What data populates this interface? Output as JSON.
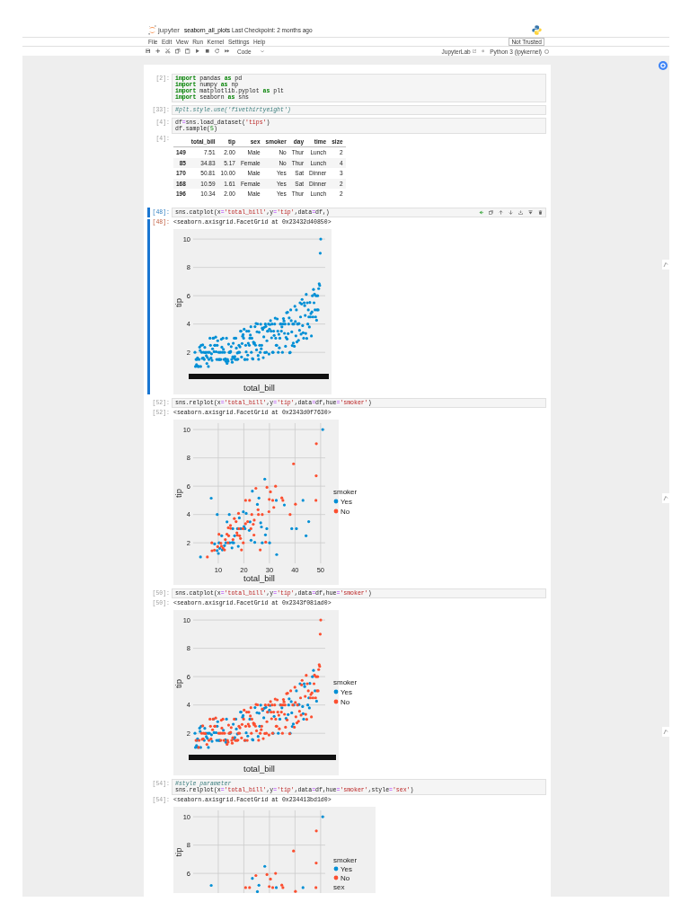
{
  "header": {
    "logo_text": "jupyter",
    "notebook_name": "seaborn_all_plots",
    "checkpoint": "Last Checkpoint: 2 months ago"
  },
  "menu": [
    "File",
    "Edit",
    "View",
    "Run",
    "Kernel",
    "Settings",
    "Help"
  ],
  "trust_status": "Not Trusted",
  "toolbar": {
    "cell_type": "Code",
    "lab_link": "JupyterLab",
    "kernel": "Python 3 (ipykernel)",
    "kernel_busy": false
  },
  "cells": [
    {
      "selected": false,
      "input_prompt": "[2]:",
      "lines": [
        [
          {
            "kind": "keyword",
            "text": "import"
          },
          {
            "kind": "plain",
            "text": " pandas "
          },
          {
            "kind": "keyword",
            "text": "as"
          },
          {
            "kind": "plain",
            "text": " pd"
          }
        ],
        [
          {
            "kind": "keyword",
            "text": "import"
          },
          {
            "kind": "plain",
            "text": " numpy "
          },
          {
            "kind": "keyword",
            "text": "as"
          },
          {
            "kind": "plain",
            "text": " np"
          }
        ],
        [
          {
            "kind": "keyword",
            "text": "import"
          },
          {
            "kind": "plain",
            "text": " matplotlib.pyplot "
          },
          {
            "kind": "keyword",
            "text": "as"
          },
          {
            "kind": "plain",
            "text": " plt"
          }
        ],
        [
          {
            "kind": "keyword",
            "text": "import"
          },
          {
            "kind": "plain",
            "text": " seaborn "
          },
          {
            "kind": "keyword",
            "text": "as"
          },
          {
            "kind": "plain",
            "text": " sns"
          }
        ]
      ]
    },
    {
      "selected": false,
      "input_prompt": "[33]:",
      "lines": [
        [
          {
            "kind": "comment",
            "text": "#plt.style.use('fivethirtyeight')"
          }
        ]
      ]
    },
    {
      "selected": false,
      "input_prompt": "[4]:",
      "lines": [
        [
          {
            "kind": "plain",
            "text": "df"
          },
          {
            "kind": "operator",
            "text": "="
          },
          {
            "kind": "plain",
            "text": "sns.load_dataset("
          },
          {
            "kind": "string",
            "text": "'tips'"
          },
          {
            "kind": "plain",
            "text": ")"
          }
        ],
        [
          {
            "kind": "plain",
            "text": "df.sample("
          },
          {
            "kind": "number",
            "text": "5"
          },
          {
            "kind": "plain",
            "text": ")"
          }
        ]
      ],
      "output": {
        "kind": "table",
        "prompt": "[4]:",
        "columns": [
          "total_bill",
          "tip",
          "sex",
          "smoker",
          "day",
          "time",
          "size"
        ],
        "rows": [
          {
            "index": "149",
            "cells": [
              "7.51",
              "2.00",
              "Male",
              "No",
              "Thur",
              "Lunch",
              "2"
            ]
          },
          {
            "index": "85",
            "cells": [
              "34.83",
              "5.17",
              "Female",
              "No",
              "Thur",
              "Lunch",
              "4"
            ]
          },
          {
            "index": "170",
            "cells": [
              "50.81",
              "10.00",
              "Male",
              "Yes",
              "Sat",
              "Dinner",
              "3"
            ]
          },
          {
            "index": "168",
            "cells": [
              "10.59",
              "1.61",
              "Female",
              "Yes",
              "Sat",
              "Dinner",
              "2"
            ]
          },
          {
            "index": "196",
            "cells": [
              "10.34",
              "2.00",
              "Male",
              "Yes",
              "Thur",
              "Lunch",
              "2"
            ]
          }
        ]
      }
    },
    {
      "selected": true,
      "input_prompt": "[48]:",
      "lines": [
        [
          {
            "kind": "plain",
            "text": "sns.catplot(x"
          },
          {
            "kind": "operator",
            "text": "="
          },
          {
            "kind": "string",
            "text": "'total_bill'"
          },
          {
            "kind": "plain",
            "text": ",y"
          },
          {
            "kind": "operator",
            "text": "="
          },
          {
            "kind": "string",
            "text": "'tip'"
          },
          {
            "kind": "plain",
            "text": ",data"
          },
          {
            "kind": "operator",
            "text": "="
          },
          {
            "kind": "plain",
            "text": "df,)"
          }
        ]
      ],
      "output": {
        "kind": "figure",
        "prompt": "[48]:",
        "text": "<seaborn.axisgrid.FacetGrid at 0x23432d40850>",
        "figure": {
          "kind": "strip",
          "xlabel": "total_bill",
          "ylabel": "tip",
          "ytick_labels": [
            "10",
            "8",
            "6",
            "4",
            "2"
          ]
        }
      }
    },
    {
      "selected": false,
      "input_prompt": "[52]:",
      "lines": [
        [
          {
            "kind": "plain",
            "text": "sns.relplot(x"
          },
          {
            "kind": "operator",
            "text": "="
          },
          {
            "kind": "string",
            "text": "'total_bill'"
          },
          {
            "kind": "plain",
            "text": ",y"
          },
          {
            "kind": "operator",
            "text": "="
          },
          {
            "kind": "string",
            "text": "'tip'"
          },
          {
            "kind": "plain",
            "text": ",data"
          },
          {
            "kind": "operator",
            "text": "="
          },
          {
            "kind": "plain",
            "text": "df,hue"
          },
          {
            "kind": "operator",
            "text": "="
          },
          {
            "kind": "string",
            "text": "'smoker'"
          },
          {
            "kind": "plain",
            "text": ")"
          }
        ]
      ],
      "output": {
        "kind": "figure",
        "prompt": "[52]:",
        "text": "<seaborn.axisgrid.FacetGrid at 0x2343d0f7630>",
        "figure": {
          "kind": "scatter",
          "xlabel": "total_bill",
          "ylabel": "tip",
          "xtick_labels": [
            "10",
            "20",
            "30",
            "40",
            "50"
          ],
          "ytick_labels": [
            "10",
            "8",
            "6",
            "4",
            "2"
          ],
          "legend_title": "smoker",
          "legend": [
            {
              "label": "Yes",
              "color": "#008fd5"
            },
            {
              "label": "No",
              "color": "#fc4f30"
            }
          ]
        }
      }
    },
    {
      "selected": false,
      "input_prompt": "[50]:",
      "lines": [
        [
          {
            "kind": "plain",
            "text": "sns.catplot(x"
          },
          {
            "kind": "operator",
            "text": "="
          },
          {
            "kind": "string",
            "text": "'total_bill'"
          },
          {
            "kind": "plain",
            "text": ",y"
          },
          {
            "kind": "operator",
            "text": "="
          },
          {
            "kind": "string",
            "text": "'tip'"
          },
          {
            "kind": "plain",
            "text": ",data"
          },
          {
            "kind": "operator",
            "text": "="
          },
          {
            "kind": "plain",
            "text": "df,hue"
          },
          {
            "kind": "operator",
            "text": "="
          },
          {
            "kind": "string",
            "text": "'smoker'"
          },
          {
            "kind": "plain",
            "text": ")"
          }
        ]
      ],
      "output": {
        "kind": "figure",
        "prompt": "[50]:",
        "text": "<seaborn.axisgrid.FacetGrid at 0x2343f081ad0>",
        "figure": {
          "kind": "strip",
          "xlabel": "total_bill",
          "ylabel": "tip",
          "ytick_labels": [
            "10",
            "8",
            "6",
            "4",
            "2"
          ],
          "legend_title": "smoker",
          "legend": [
            {
              "label": "Yes",
              "color": "#008fd5"
            },
            {
              "label": "No",
              "color": "#fc4f30"
            }
          ]
        }
      }
    },
    {
      "selected": false,
      "input_prompt": "[54]:",
      "lines": [
        [
          {
            "kind": "comment",
            "text": "#style parameter"
          }
        ],
        [
          {
            "kind": "plain",
            "text": "sns.relplot(x"
          },
          {
            "kind": "operator",
            "text": "="
          },
          {
            "kind": "string",
            "text": "'total_bill'"
          },
          {
            "kind": "plain",
            "text": ",y"
          },
          {
            "kind": "operator",
            "text": "="
          },
          {
            "kind": "string",
            "text": "'tip'"
          },
          {
            "kind": "plain",
            "text": ",data"
          },
          {
            "kind": "operator",
            "text": "="
          },
          {
            "kind": "plain",
            "text": "df,hue"
          },
          {
            "kind": "operator",
            "text": "="
          },
          {
            "kind": "string",
            "text": "'smoker'"
          },
          {
            "kind": "plain",
            "text": ",style"
          },
          {
            "kind": "operator",
            "text": "="
          },
          {
            "kind": "string",
            "text": "'sex'"
          },
          {
            "kind": "plain",
            "text": ")"
          }
        ]
      ],
      "output": {
        "kind": "figure",
        "prompt": "[54]:",
        "text": "<seaborn.axisgrid.FacetGrid at 0x234413bd1d0>",
        "figure": {
          "kind": "scatter",
          "ylabel": "tip",
          "ytick_labels": [
            "10",
            "8",
            "6"
          ],
          "legend_title": "smoker",
          "legend": [
            {
              "label": "Yes",
              "color": "#008fd5"
            },
            {
              "label": "No",
              "color": "#fc4f30"
            }
          ],
          "legend_title_2": "sex"
        }
      }
    }
  ]
}
